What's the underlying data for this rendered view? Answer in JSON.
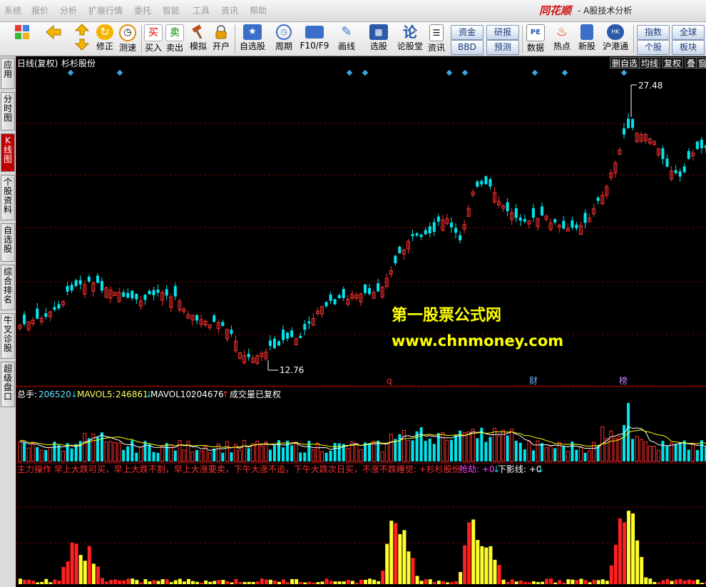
{
  "menu": [
    "系统",
    "报价",
    "分析",
    "扩展行情",
    "委托",
    "智能",
    "工具",
    "资讯",
    "帮助"
  ],
  "brand": "同花顺",
  "app_title": "- A股技术分析",
  "toolbar": {
    "left": [
      {
        "label": "",
        "icon": "grid-icon"
      },
      {
        "label": "",
        "icon": "back-arrow-icon"
      },
      {
        "label": "",
        "icon": "up-down-arrow-icon"
      },
      {
        "label": "修正",
        "icon": "refresh-icon"
      },
      {
        "label": "测速",
        "icon": "clock-icon"
      },
      {
        "label": "买入",
        "icon": "buy-icon",
        "glyph": "买"
      },
      {
        "label": "卖出",
        "icon": "sell-icon",
        "glyph": "卖"
      },
      {
        "label": "模拟",
        "icon": "hammer-icon"
      },
      {
        "label": "开户",
        "icon": "lock-icon"
      },
      {
        "label": "自选股",
        "icon": "star-icon"
      },
      {
        "label": "周期",
        "icon": "period-icon"
      },
      {
        "label": "F10/F9",
        "icon": "f10-icon"
      },
      {
        "label": "画线",
        "icon": "pen-icon"
      },
      {
        "label": "选股",
        "icon": "select-stock-icon"
      },
      {
        "label": "论股堂",
        "icon": "forum-icon",
        "glyph": "论"
      },
      {
        "label": "资讯",
        "icon": "news-icon"
      }
    ],
    "pills_a": [
      "资金",
      "BBD"
    ],
    "pills_b": [
      "研报",
      "预测"
    ],
    "right": [
      {
        "label": "数据",
        "icon": "pe-icon",
        "glyph": "PE"
      },
      {
        "label": "热点",
        "icon": "hot-icon"
      },
      {
        "label": "新股",
        "icon": "new-stock-icon"
      },
      {
        "label": "沪港通",
        "icon": "hk-connect-icon"
      }
    ],
    "pills_c": [
      "指数",
      "个股"
    ],
    "pills_d": [
      "全球",
      "板块"
    ]
  },
  "sidebar": {
    "tabs": [
      {
        "label": "应用",
        "active": false
      },
      {
        "label": "分时图",
        "active": false
      },
      {
        "label": "K线图",
        "active": true
      },
      {
        "label": "个股资料",
        "active": false
      },
      {
        "label": "自选股",
        "active": false
      },
      {
        "label": "综合排名",
        "active": false
      },
      {
        "label": "牛叉诊股",
        "active": false
      },
      {
        "label": "超级盘口",
        "active": false
      }
    ]
  },
  "header": {
    "period": "日线(复权)",
    "stock": "杉杉股份",
    "buttons": [
      "删自选",
      "均线",
      "复权",
      "叠",
      "窗"
    ]
  },
  "price": {
    "high_label": "27.48",
    "low_label": "12.76",
    "event_markers": [
      "q",
      "财",
      "榜"
    ]
  },
  "volume": {
    "label_total": "总手:",
    "total": "206520",
    "label_ma5": "MAVOL5:",
    "ma5": "246861",
    "label_ma10": "MAVOL10:",
    "ma10": "204676",
    "note": "成交量已复权"
  },
  "indicator": {
    "text": "主力操作 早上大跌可买，早上大跌不割，早上大涨要卖，下午大涨不追，下午大跌次日买，不涨不跌睡觉: +杉杉股份",
    "qiang_label": "抢劫: +0",
    "shadow_label": "下影线: +0"
  },
  "watermark": {
    "line1": "第一股票公式网",
    "line2": "www.chnmoney.com"
  },
  "colors": {
    "up": "#ff3030",
    "down": "#00e5ee",
    "ma_white": "#ffffff",
    "ma_yellow": "#ffff00",
    "grid": "#7a0000",
    "marker": "#3aa6e0"
  }
}
